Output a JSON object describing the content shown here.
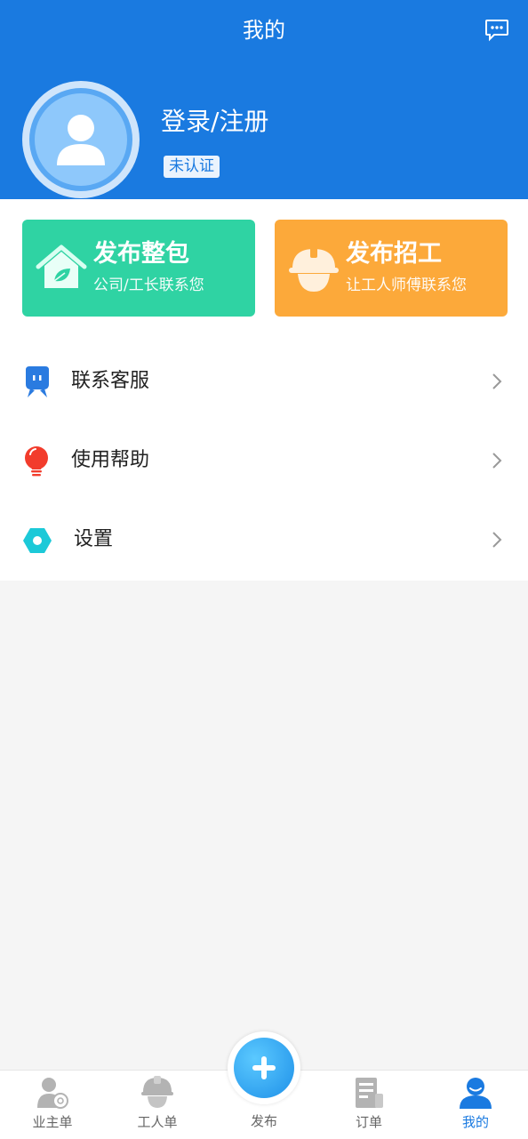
{
  "header": {
    "title": "我的",
    "login_label": "登录/注册",
    "verify_badge": "未认证",
    "colors": {
      "primary": "#1a7ae0"
    }
  },
  "icons": {
    "message": "chat-bubble-icon",
    "avatar": "user-avatar-icon"
  },
  "cards": [
    {
      "title": "发布整包",
      "subtitle": "公司/工长联系您",
      "icon": "house-leaf-icon",
      "color": "#2fd3a3"
    },
    {
      "title": "发布招工",
      "subtitle": "让工人师傅联系您",
      "icon": "hard-hat-icon",
      "color": "#fca93a"
    }
  ],
  "menu": [
    {
      "label": "联系客服",
      "icon": "customer-service-icon"
    },
    {
      "label": "使用帮助",
      "icon": "lightbulb-icon"
    },
    {
      "label": "设置",
      "icon": "hexagon-settings-icon"
    }
  ],
  "tabbar": {
    "items": [
      {
        "label": "业主单",
        "icon": "owner-icon"
      },
      {
        "label": "工人单",
        "icon": "worker-icon"
      },
      {
        "label": "发布",
        "icon": "plus-icon"
      },
      {
        "label": "订单",
        "icon": "order-icon"
      },
      {
        "label": "我的",
        "icon": "profile-icon",
        "active": true
      }
    ]
  }
}
